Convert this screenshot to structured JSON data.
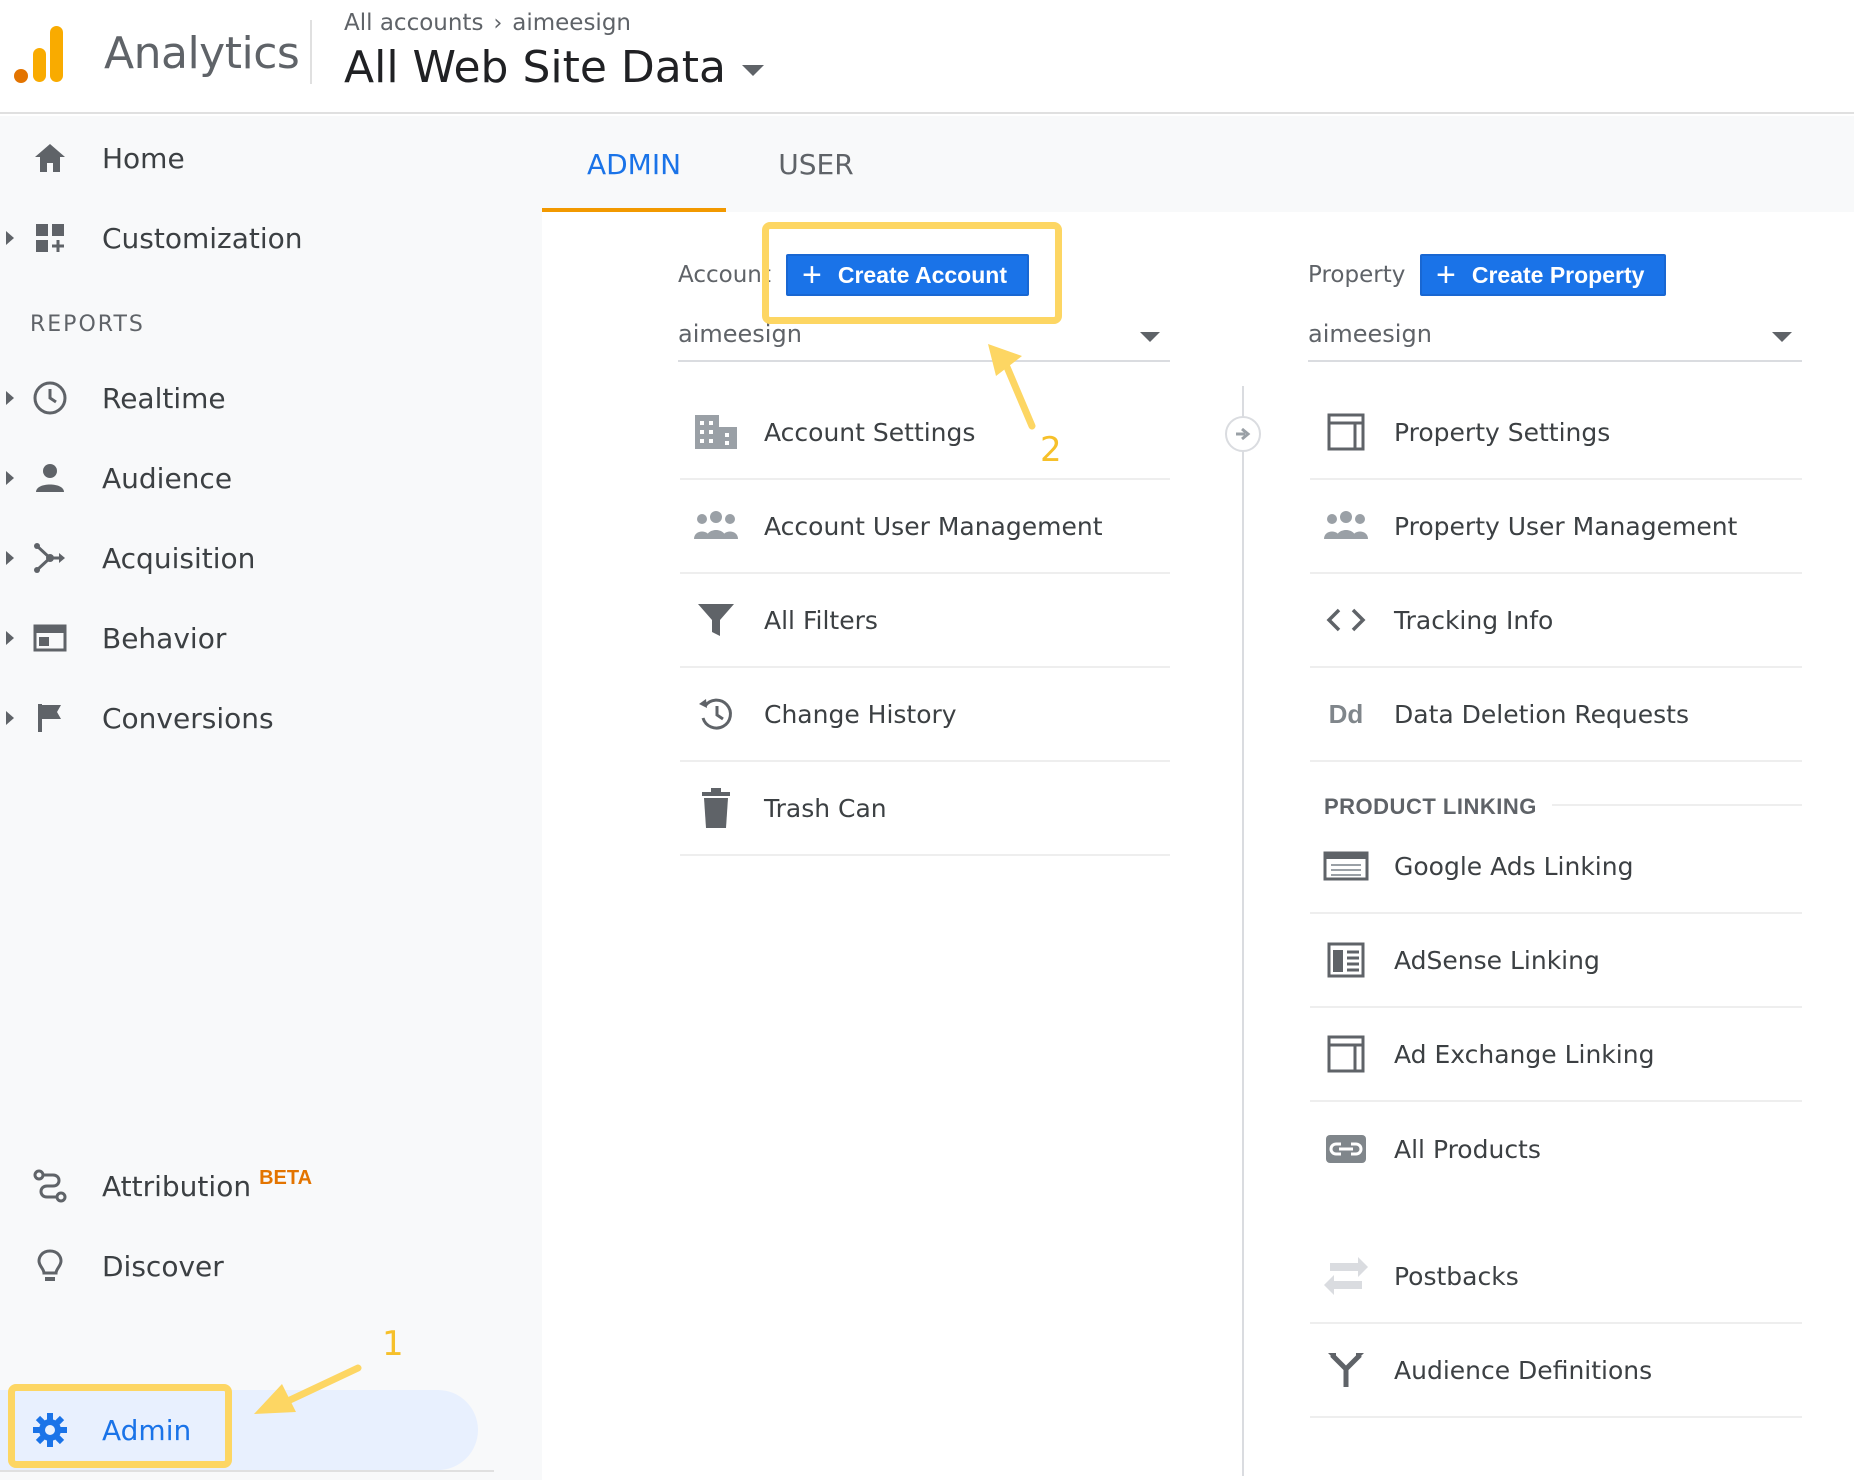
{
  "header": {
    "app_name": "Analytics",
    "breadcrumb": [
      "All accounts",
      "aimeesign"
    ],
    "view_title": "All Web Site Data"
  },
  "sidebar": {
    "home": "Home",
    "customization": "Customization",
    "reports_heading": "REPORTS",
    "realtime": "Realtime",
    "audience": "Audience",
    "acquisition": "Acquisition",
    "behavior": "Behavior",
    "conversions": "Conversions",
    "attribution": "Attribution",
    "beta_badge": "BETA",
    "discover": "Discover",
    "admin": "Admin"
  },
  "tabs": {
    "admin": "ADMIN",
    "user": "USER"
  },
  "account_column": {
    "label": "Account",
    "create_button": "Create Account",
    "selected": "aimeesign",
    "items": [
      "Account Settings",
      "Account User Management",
      "All Filters",
      "Change History",
      "Trash Can"
    ]
  },
  "property_column": {
    "label": "Property",
    "create_button": "Create Property",
    "selected": "aimeesign",
    "items": [
      "Property Settings",
      "Property User Management",
      "Tracking Info",
      "Data Deletion Requests"
    ],
    "dd_glyph": "Dd",
    "product_linking_heading": "PRODUCT LINKING",
    "linking_items": [
      "Google Ads Linking",
      "AdSense Linking",
      "Ad Exchange Linking",
      "All Products"
    ],
    "other_items": [
      "Postbacks",
      "Audience Definitions"
    ]
  },
  "annotations": {
    "step1": "1",
    "step2": "2",
    "highlight_color": "#fdd663"
  },
  "colors": {
    "accent_blue": "#1a73e8",
    "tab_underline": "#f29900",
    "beta_orange": "#e37400"
  }
}
